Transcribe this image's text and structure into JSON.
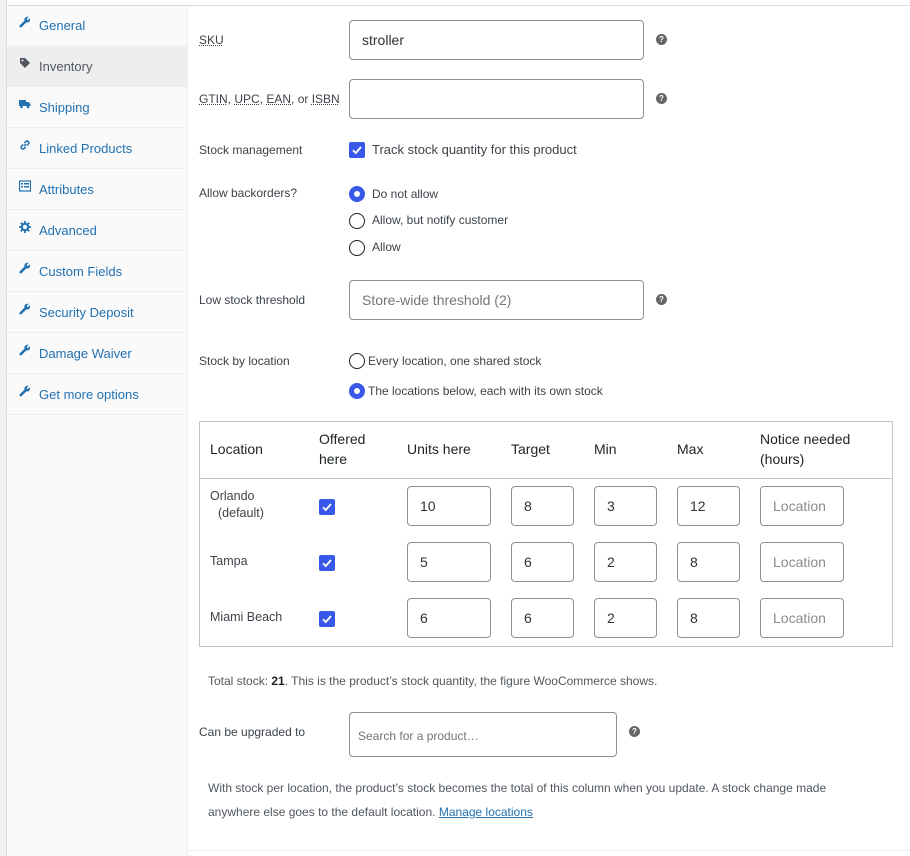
{
  "sidebar": {
    "items": [
      {
        "label": "General",
        "icon": "wrench-icon"
      },
      {
        "label": "Inventory",
        "icon": "tag-icon"
      },
      {
        "label": "Shipping",
        "icon": "truck-icon"
      },
      {
        "label": "Linked Products",
        "icon": "link-icon"
      },
      {
        "label": "Attributes",
        "icon": "list-icon"
      },
      {
        "label": "Advanced",
        "icon": "gear-icon"
      },
      {
        "label": "Custom Fields",
        "icon": "wrench-icon"
      },
      {
        "label": "Security Deposit",
        "icon": "wrench-icon"
      },
      {
        "label": "Damage Waiver",
        "icon": "wrench-icon"
      },
      {
        "label": "Get more options",
        "icon": "wrench-icon"
      }
    ],
    "active": "Inventory"
  },
  "form": {
    "sku_label": "SKU",
    "sku_value": "stroller",
    "gtin_label_parts": [
      "GTIN",
      ", ",
      "UPC",
      ", ",
      "EAN",
      ", or ",
      "ISBN"
    ],
    "gtin_value": "",
    "stock_mgmt_label": "Stock management",
    "stock_mgmt_checkbox": "Track stock quantity for this product",
    "backorders_label": "Allow backorders?",
    "backorders_options": [
      "Do not allow",
      "Allow, but notify customer",
      "Allow"
    ],
    "backorders_selected": "Do not allow",
    "low_stock_label": "Low stock threshold",
    "low_stock_placeholder": "Store-wide threshold (2)",
    "stock_by_location_label": "Stock by location",
    "stock_by_location_options": [
      "Every location, one shared stock",
      "The locations below, each with its own stock"
    ],
    "stock_by_location_selected": "The locations below, each with its own stock"
  },
  "locations_table": {
    "headers": {
      "location": "Location",
      "offered_1": "Offered",
      "offered_2": "here",
      "units": "Units here",
      "target": "Target",
      "min": "Min",
      "max": "Max",
      "notice_1": "Notice needed",
      "notice_2": "(hours)"
    },
    "notice_placeholder": "Location",
    "rows": [
      {
        "name": "Orlando",
        "sub": "(default)",
        "offered": true,
        "units": "10",
        "target": "8",
        "min": "3",
        "max": "12"
      },
      {
        "name": "Tampa",
        "sub": "",
        "offered": true,
        "units": "5",
        "target": "6",
        "min": "2",
        "max": "8"
      },
      {
        "name": "Miami Beach",
        "sub": "",
        "offered": true,
        "units": "6",
        "target": "6",
        "min": "2",
        "max": "8"
      }
    ]
  },
  "total": {
    "prefix": "Total stock: ",
    "value": "21",
    "suffix": ". This is the product’s stock quantity, the figure WooCommerce shows."
  },
  "upgrade": {
    "label": "Can be upgraded to",
    "placeholder": "Search for a product…"
  },
  "footnote": {
    "line1": "With stock per location, the product’s stock becomes the total of this column when you update. A stock change made",
    "line2": "anywhere else goes to the default location. ",
    "link": "Manage locations"
  },
  "colors": {
    "link": "#2271b1",
    "accent": "#3858e9"
  }
}
